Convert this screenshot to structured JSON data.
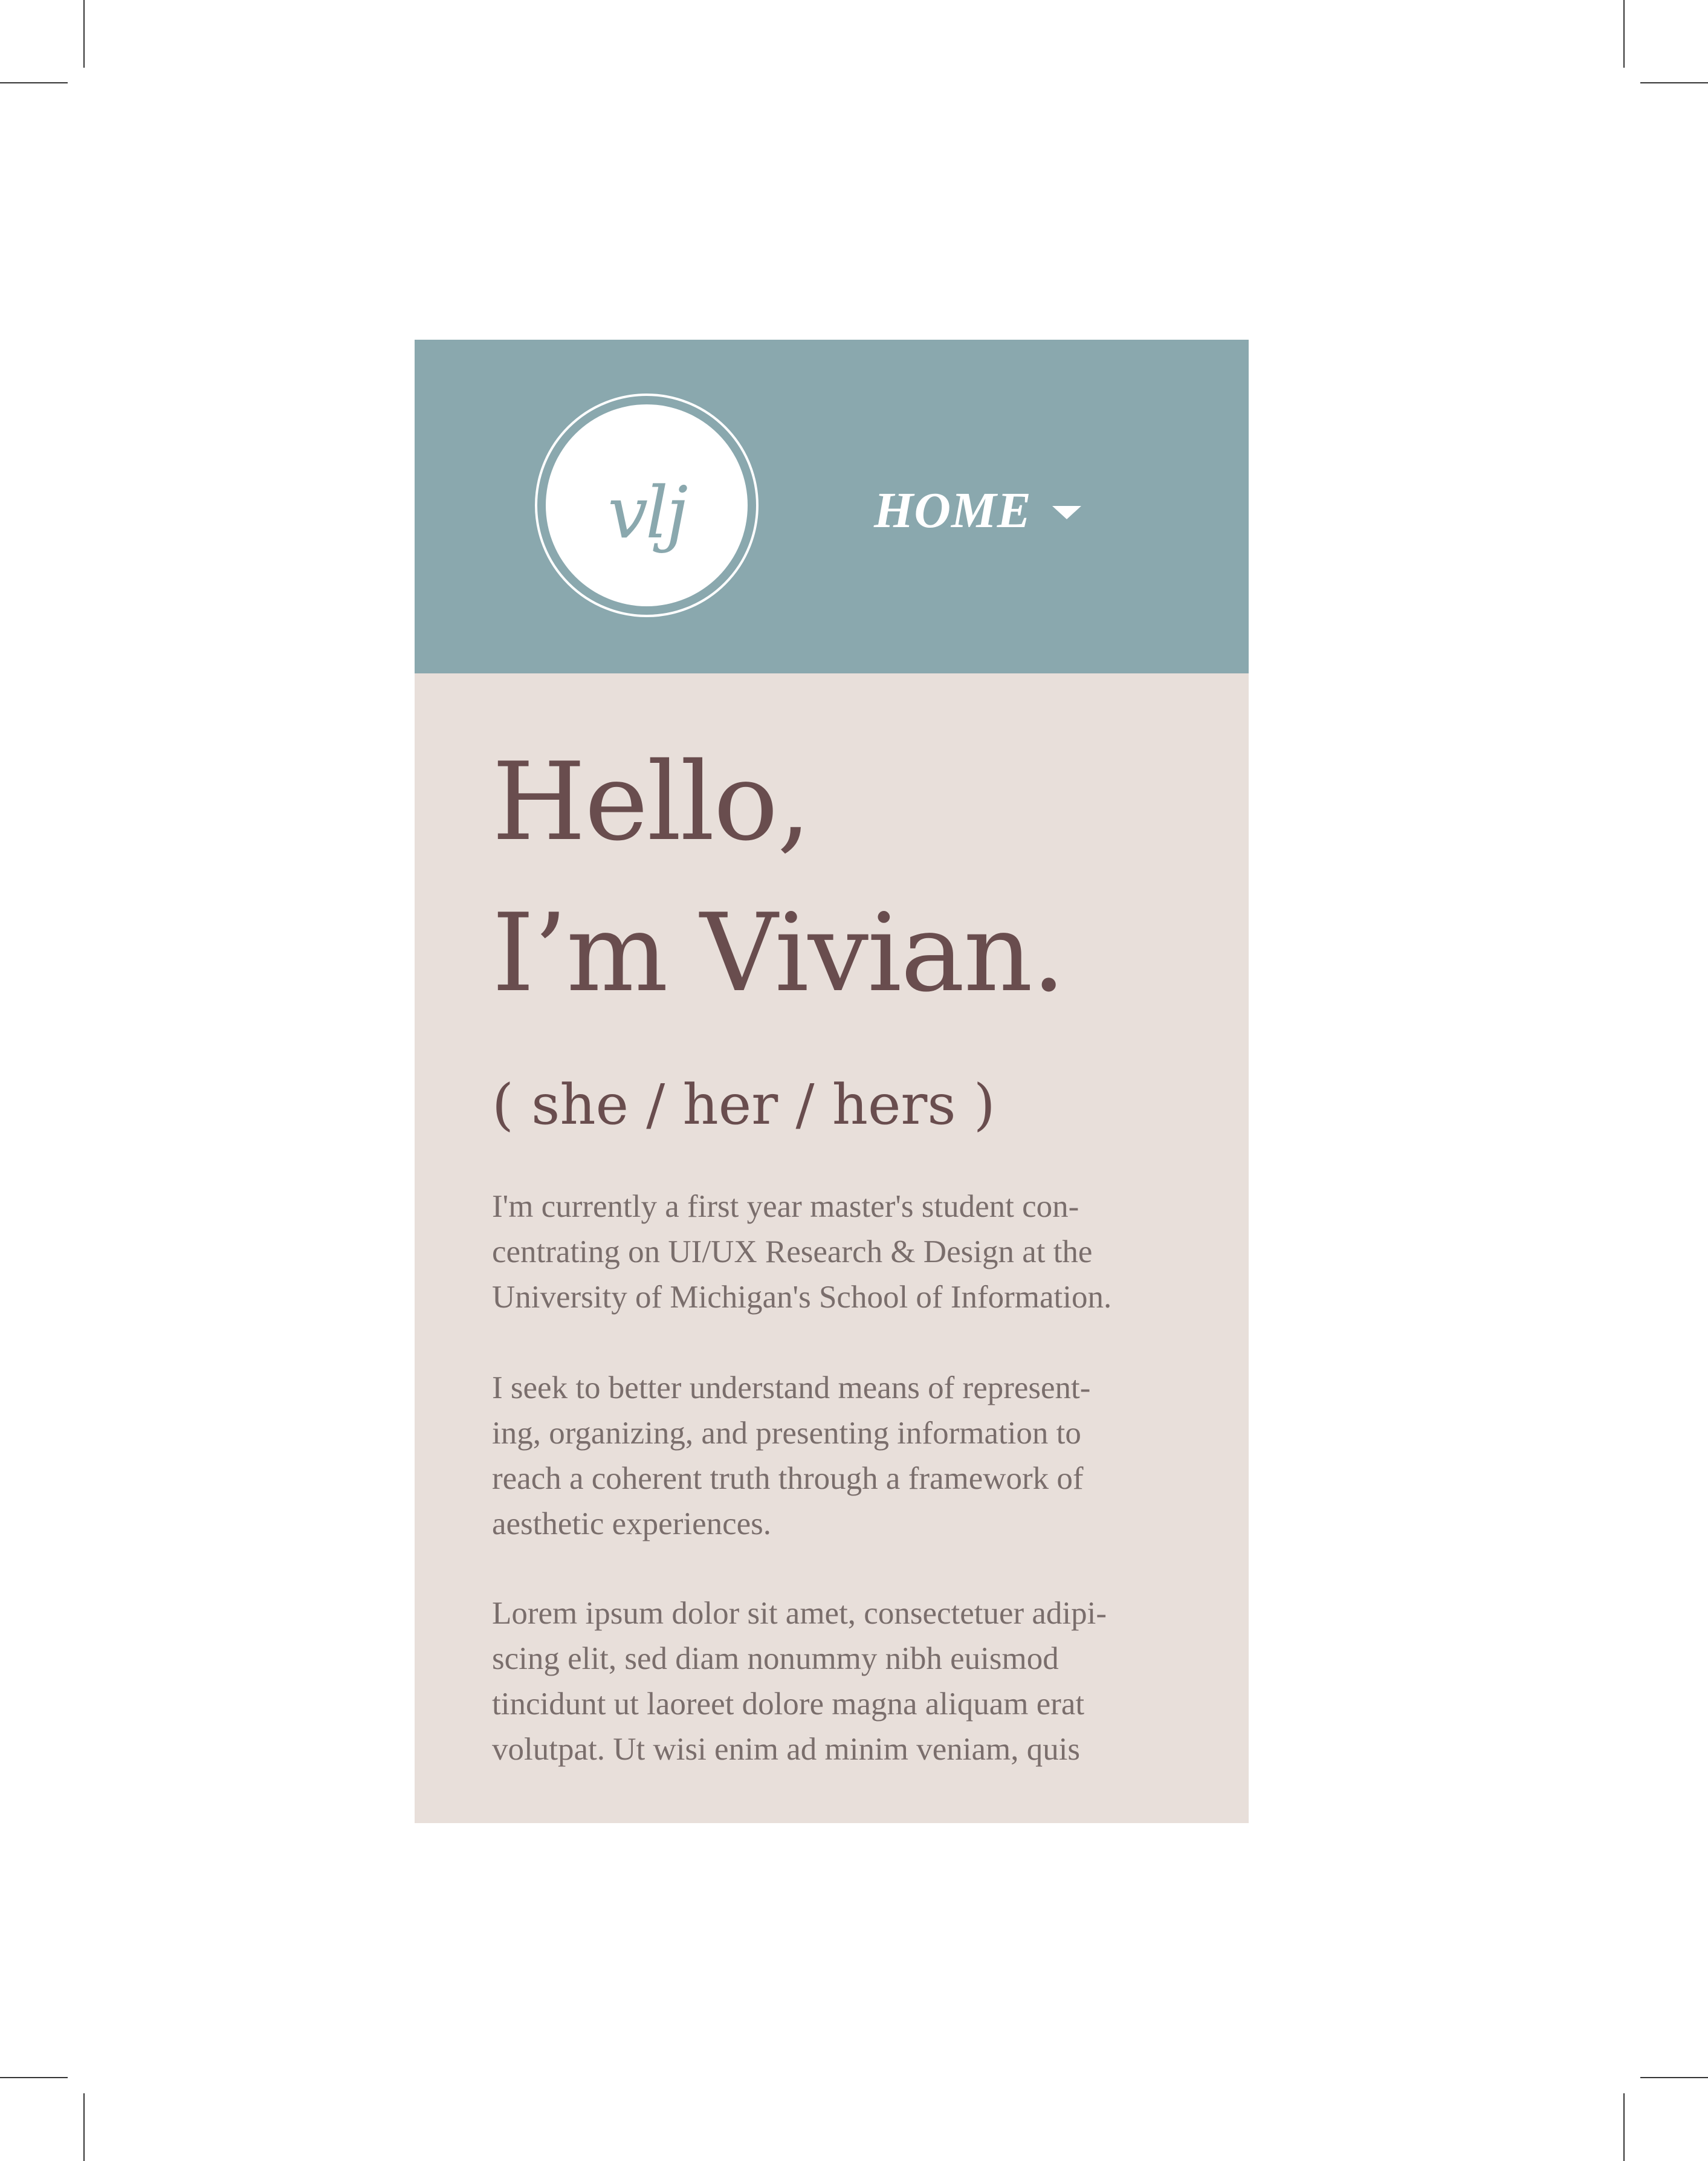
{
  "header": {
    "logo_text": "vlj",
    "nav_label": "HOME"
  },
  "hero": {
    "greeting_line1": "Hello,",
    "greeting_line2": "I’m Vivian.",
    "pronouns": "( she / her / hers )"
  },
  "paragraphs": [
    {
      "lines": [
        "I'm currently a first year master's student con-",
        "centrating on UI/UX Research & Design at the",
        "University of Michigan's School of Information."
      ]
    },
    {
      "lines": [
        "I seek to better understand means of represent-",
        "ing, organizing, and presenting information to",
        "reach a coherent truth through a framework of",
        "aesthetic experiences."
      ]
    },
    {
      "lines": [
        "Lorem ipsum dolor sit amet, consectetuer adipi-",
        "scing elit, sed diam nonummy nibh euismod",
        "tincidunt ut laoreet dolore magna aliquam erat",
        "volutpat. Ut wisi enim ad minim veniam, quis"
      ]
    }
  ],
  "colors": {
    "header_bg": "#8aa8ae",
    "page_bg": "#e8dfda",
    "heading_text": "#694d4e",
    "body_text": "#7a6e6c"
  },
  "icons": {
    "nav_caret": "caret-down-icon"
  }
}
